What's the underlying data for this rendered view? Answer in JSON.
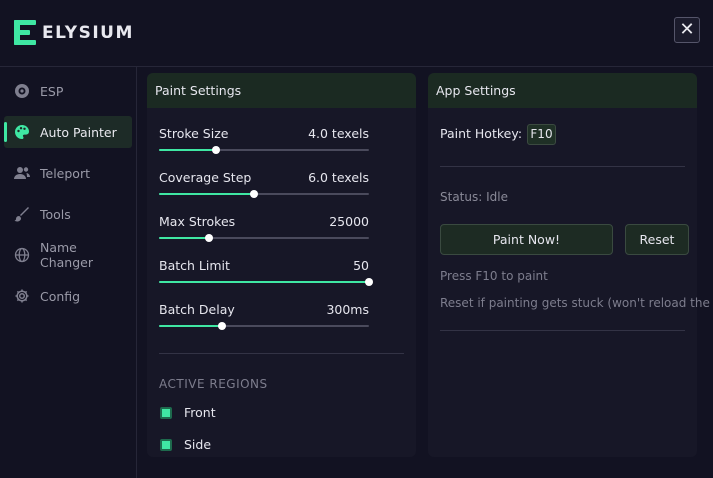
{
  "app": {
    "title": "ELYSIUM",
    "close_label": "✕"
  },
  "colors": {
    "accent": "#3fe7a3",
    "background": "#121222",
    "panel": "#171727",
    "panel_header": "#1b2a22"
  },
  "sidebar": {
    "items": [
      {
        "label": "ESP",
        "icon": "eye-icon",
        "active": false
      },
      {
        "label": "Auto Painter",
        "icon": "palette-icon",
        "active": true
      },
      {
        "label": "Teleport",
        "icon": "users-icon",
        "active": false
      },
      {
        "label": "Tools",
        "icon": "brush-icon",
        "active": false
      },
      {
        "label": "Name Changer",
        "icon": "globe-icon",
        "active": false
      },
      {
        "label": "Config",
        "icon": "gear-icon",
        "active": false
      }
    ]
  },
  "paint_settings": {
    "title": "Paint Settings",
    "sliders": [
      {
        "label": "Stroke Size",
        "value": "4.0 texels",
        "fraction": 0.27
      },
      {
        "label": "Coverage Step",
        "value": "6.0 texels",
        "fraction": 0.45
      },
      {
        "label": "Max Strokes",
        "value": "25000",
        "fraction": 0.24
      },
      {
        "label": "Batch Limit",
        "value": "50",
        "fraction": 1.0
      },
      {
        "label": "Batch Delay",
        "value": "300ms",
        "fraction": 0.3
      }
    ],
    "regions_label": "ACTIVE REGIONS",
    "regions": [
      {
        "label": "Front",
        "checked": true
      },
      {
        "label": "Side",
        "checked": true
      }
    ]
  },
  "app_settings": {
    "title": "App Settings",
    "hotkey_label": "Paint Hotkey:",
    "hotkey_value": "F10",
    "status": "Status: Idle",
    "paint_button": "Paint Now!",
    "reset_button": "Reset",
    "hint_paint": "Press F10 to paint",
    "hint_reset": "Reset if painting gets stuck (won't reload the l"
  }
}
